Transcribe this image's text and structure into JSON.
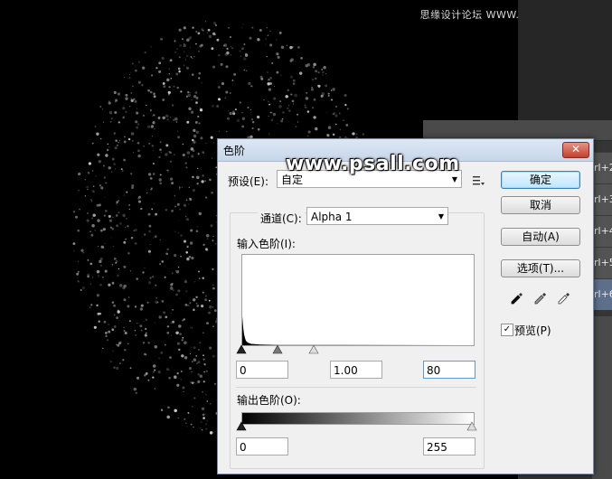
{
  "watermark": "思缘设计论坛 WWW.MISSYUAN.COM",
  "banner": "www.psall.com",
  "layers_panel": {
    "rows": [
      "rl+2",
      "rl+3",
      "rl+4",
      "rl+5",
      "rl+6"
    ]
  },
  "dialog": {
    "title": "色阶",
    "close_glyph": "✕",
    "preset_label": "预设(E):",
    "preset_value": "自定",
    "channel_label": "通道(C):",
    "channel_value": "Alpha 1",
    "input_levels_label": "输入色阶(I):",
    "output_levels_label": "输出色阶(O):",
    "input_black": "0",
    "input_gamma": "1.00",
    "input_white": "80",
    "output_black": "0",
    "output_white": "255",
    "buttons": {
      "ok": "确定",
      "cancel": "取消",
      "auto": "自动(A)",
      "options": "选项(T)..."
    },
    "preview_label": "预览(P)",
    "preview_checked": "✓"
  }
}
